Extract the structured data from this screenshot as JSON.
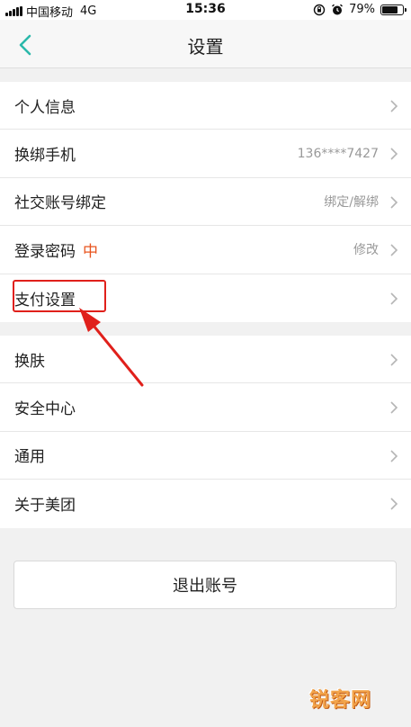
{
  "status_bar": {
    "carrier": "中国移动",
    "network": "4G",
    "time": "15:36",
    "battery": "79%",
    "battery_level": 0.79
  },
  "nav": {
    "title": "设置",
    "back_icon": "chevron-left-icon",
    "accent": "#2bb8aa"
  },
  "group1": [
    {
      "label": "个人信息",
      "value": ""
    },
    {
      "label": "换绑手机",
      "value": "136****7427"
    },
    {
      "label": "社交账号绑定",
      "value": "绑定/解绑"
    },
    {
      "label": "登录密码",
      "badge": "中",
      "value": "修改"
    },
    {
      "label": "支付设置",
      "value": ""
    }
  ],
  "group2": [
    {
      "label": "换肤"
    },
    {
      "label": "安全中心"
    },
    {
      "label": "通用"
    },
    {
      "label": "关于美团"
    }
  ],
  "logout_label": "退出账号",
  "watermark": "锐客网",
  "colors": {
    "badge": "#e8541e",
    "highlight": "#e0201b"
  }
}
